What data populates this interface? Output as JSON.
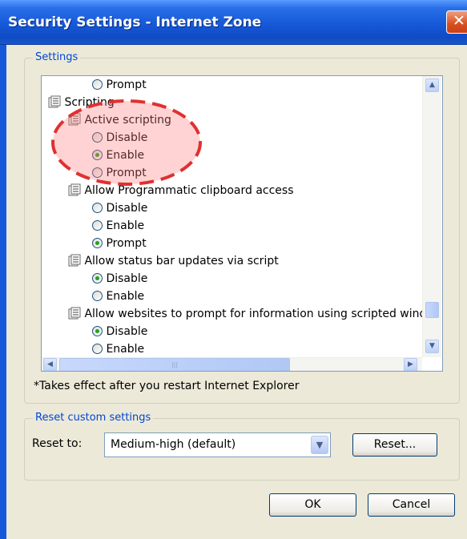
{
  "window": {
    "title": "Security Settings - Internet Zone",
    "close_glyph": "✕"
  },
  "settings_group": {
    "label": "Settings"
  },
  "tree": {
    "rows": [
      {
        "type": "option",
        "label": "Prompt",
        "checked": false
      },
      {
        "type": "category",
        "label": "Scripting",
        "icon": "settings-category-icon"
      },
      {
        "type": "setting",
        "label": "Active scripting",
        "icon": "settings-item-icon"
      },
      {
        "type": "option",
        "label": "Disable",
        "checked": false
      },
      {
        "type": "option",
        "label": "Enable",
        "checked": true
      },
      {
        "type": "option",
        "label": "Prompt",
        "checked": false
      },
      {
        "type": "setting",
        "label": "Allow Programmatic clipboard access",
        "icon": "settings-item-icon"
      },
      {
        "type": "option",
        "label": "Disable",
        "checked": false
      },
      {
        "type": "option",
        "label": "Enable",
        "checked": false
      },
      {
        "type": "option",
        "label": "Prompt",
        "checked": true
      },
      {
        "type": "setting",
        "label": "Allow status bar updates via script",
        "icon": "settings-item-icon"
      },
      {
        "type": "option",
        "label": "Disable",
        "checked": true
      },
      {
        "type": "option",
        "label": "Enable",
        "checked": false
      },
      {
        "type": "setting",
        "label": "Allow websites to prompt for information using scripted windows",
        "icon": "settings-item-icon"
      },
      {
        "type": "option",
        "label": "Disable",
        "checked": true
      },
      {
        "type": "option",
        "label": "Enable",
        "checked": false
      }
    ]
  },
  "scrollbar": {
    "up": "▲",
    "down": "▼",
    "left": "◀",
    "right": "▶",
    "grip": "|||"
  },
  "note": "*Takes effect after you restart Internet Explorer",
  "reset_group": {
    "label": "Reset custom settings",
    "reset_to_label": "Reset to:",
    "selected": "Medium-high (default)",
    "dropdown_glyph": "▼",
    "reset_button": "Reset..."
  },
  "buttons": {
    "ok": "OK",
    "cancel": "Cancel"
  },
  "colors": {
    "title_bar": "#1659d8",
    "dialog_bg": "#ece9d8",
    "group_label": "#0046d5",
    "highlight_circle": "#e03030"
  }
}
